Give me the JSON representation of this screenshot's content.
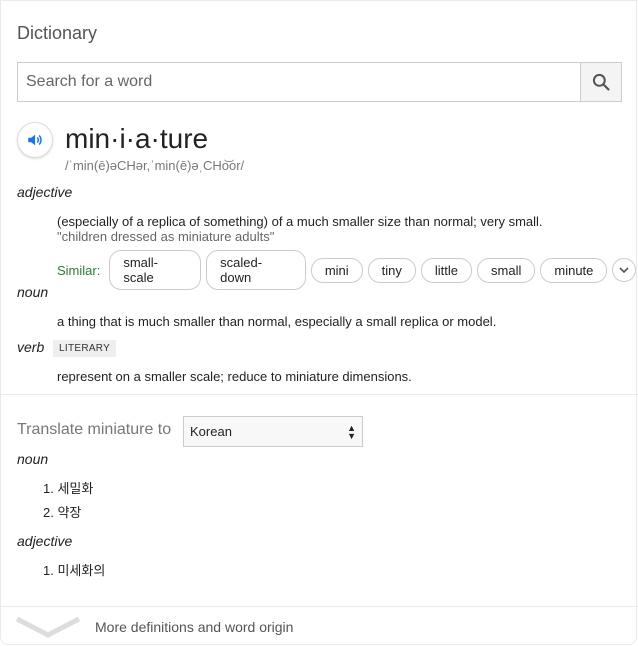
{
  "header": {
    "title": "Dictionary"
  },
  "search": {
    "placeholder": "Search for a word"
  },
  "entry": {
    "word": "min·i·a·ture",
    "phonetic": "/ˈmin(ē)əCHər,ˈmin(ē)əˌCHo͝or/",
    "senses": [
      {
        "pos": "adjective",
        "definition": "(especially of a replica of something) of a much smaller size than normal; very small.",
        "example": "\"children dressed as miniature adults\"",
        "similar_label": "Similar:",
        "similar": [
          "small-scale",
          "scaled-down",
          "mini",
          "tiny",
          "little",
          "small",
          "minute"
        ]
      },
      {
        "pos": "noun",
        "definition": "a thing that is much smaller than normal, especially a small replica or model."
      },
      {
        "pos": "verb",
        "badge": "LITERARY",
        "definition": "represent on a smaller scale; reduce to miniature dimensions."
      }
    ]
  },
  "translate": {
    "label": "Translate miniature to",
    "language": "Korean",
    "groups": [
      {
        "pos": "noun",
        "items": [
          "1.  세밀화",
          "2.  약장"
        ]
      },
      {
        "pos": "adjective",
        "items": [
          "1.  미세화의"
        ]
      }
    ]
  },
  "footer": {
    "more_label": "More definitions and word origin"
  },
  "colors": {
    "accent": "#1a73e8",
    "similar": "#2e7d32"
  }
}
